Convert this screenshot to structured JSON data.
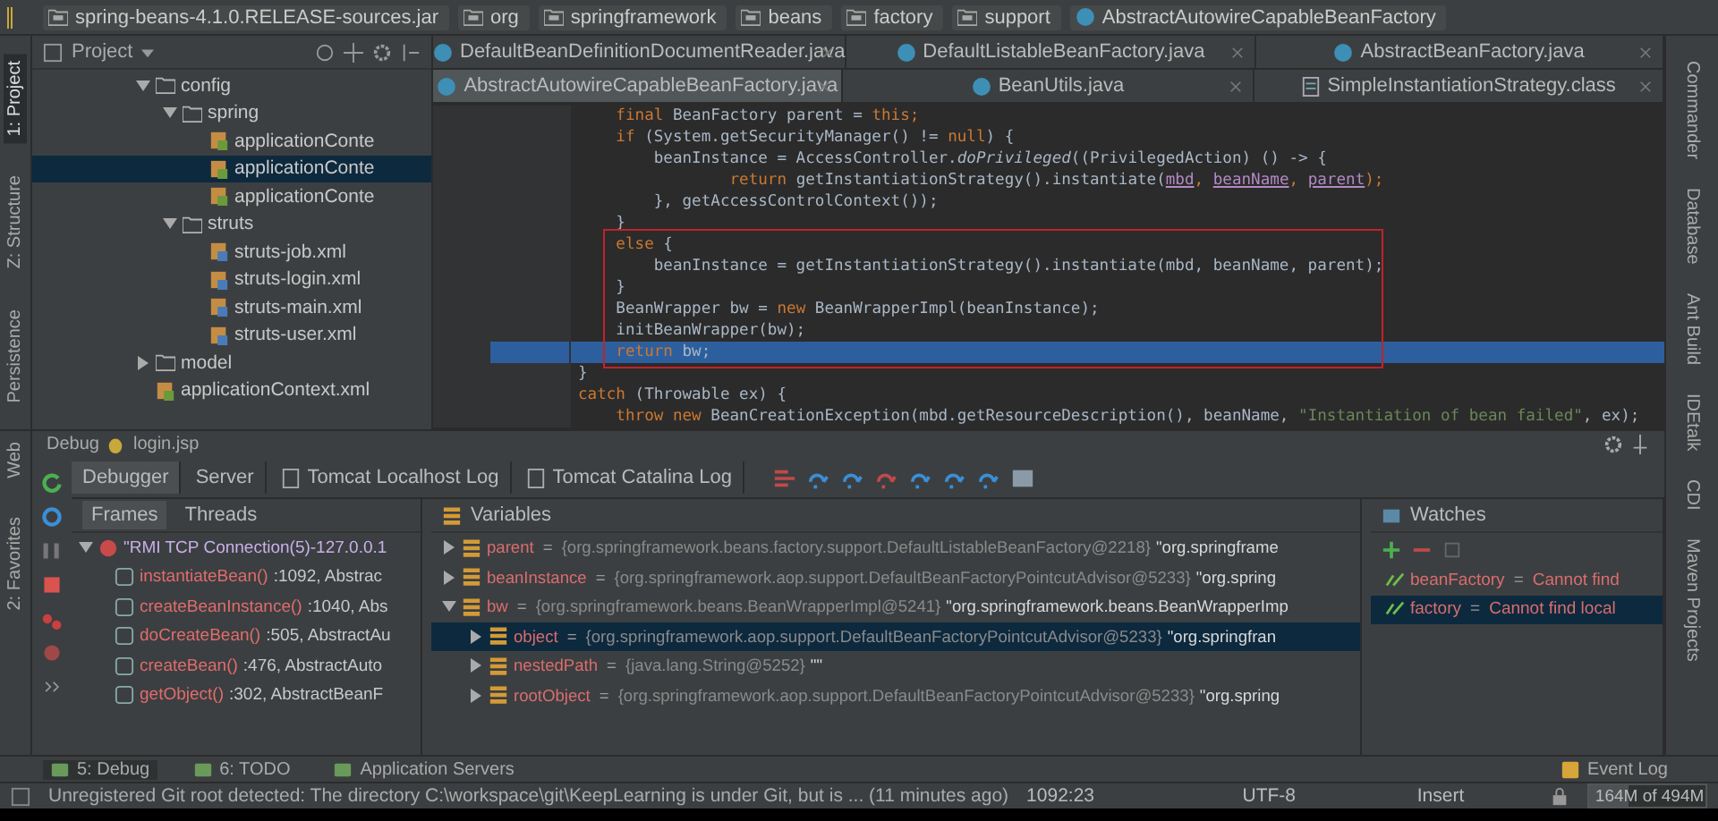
{
  "breadcrumbs": [
    {
      "label": "spring-beans-4.1.0.RELEASE-sources.jar",
      "kind": "jar"
    },
    {
      "label": "org",
      "kind": "package"
    },
    {
      "label": "springframework",
      "kind": "package"
    },
    {
      "label": "beans",
      "kind": "package"
    },
    {
      "label": "factory",
      "kind": "package"
    },
    {
      "label": "support",
      "kind": "package"
    },
    {
      "label": "AbstractAutowireCapableBeanFactory",
      "kind": "class"
    }
  ],
  "left_tool_strip": [
    {
      "label": "1: Project",
      "selected": true
    },
    {
      "label": "Z: Structure",
      "selected": false
    },
    {
      "label": "Persistence",
      "selected": false
    },
    {
      "label": "Web",
      "selected": false
    },
    {
      "label": "2: Favorites",
      "selected": false
    }
  ],
  "right_tool_strip": [
    "Commander",
    "Database",
    "Ant Build",
    "IDEtalk",
    "CDI",
    "Maven Projects"
  ],
  "project": {
    "title": "Project",
    "tree": [
      {
        "label": "config",
        "kind": "folder",
        "expanded": true,
        "selected": false,
        "children": [
          {
            "label": "spring",
            "kind": "folder",
            "expanded": true,
            "selected": false,
            "children": [
              {
                "label": "applicationConte",
                "kind": "spring-xml",
                "selected": false
              },
              {
                "label": "applicationConte",
                "kind": "spring-xml",
                "selected": true
              },
              {
                "label": "applicationConte",
                "kind": "spring-xml",
                "selected": false
              }
            ]
          },
          {
            "label": "struts",
            "kind": "folder",
            "expanded": true,
            "selected": false,
            "children": [
              {
                "label": "struts-job.xml",
                "kind": "xml",
                "selected": false
              },
              {
                "label": "struts-login.xml",
                "kind": "xml",
                "selected": false
              },
              {
                "label": "struts-main.xml",
                "kind": "xml",
                "selected": false
              },
              {
                "label": "struts-user.xml",
                "kind": "xml",
                "selected": false
              }
            ]
          }
        ]
      },
      {
        "label": "model",
        "kind": "folder",
        "expanded": false,
        "selected": false
      },
      {
        "label": "applicationContext.xml",
        "kind": "spring-xml",
        "selected": false
      }
    ]
  },
  "editor": {
    "tab_rows": [
      [
        {
          "label": "DefaultBeanDefinitionDocumentReader.java",
          "kind": "java",
          "selected": false
        },
        {
          "label": "DefaultListableBeanFactory.java",
          "kind": "java",
          "selected": false
        },
        {
          "label": "AbstractBeanFactory.java",
          "kind": "java",
          "selected": false
        }
      ],
      [
        {
          "label": "AbstractAutowireCapableBeanFactory.java",
          "kind": "java",
          "selected": true
        },
        {
          "label": "BeanUtils.java",
          "kind": "java",
          "selected": false
        },
        {
          "label": "SimpleInstantiationStrategy.class",
          "kind": "class",
          "selected": false
        }
      ]
    ],
    "lines": [
      {
        "current": false,
        "boxed": false,
        "segments": [
          {
            "text": "    final",
            "kind": "kw"
          },
          {
            "text": " BeanFactory parent = ",
            "kind": "plain"
          },
          {
            "text": "this",
            "kind": "kw"
          },
          {
            "text": ";",
            "kind": "kw"
          }
        ]
      },
      {
        "current": false,
        "boxed": false,
        "segments": [
          {
            "text": "    if",
            "kind": "kw"
          },
          {
            "text": " (System.getSecurityManager() != ",
            "kind": "plain"
          },
          {
            "text": "null",
            "kind": "kw"
          },
          {
            "text": ") {",
            "kind": "plain"
          }
        ]
      },
      {
        "current": false,
        "boxed": false,
        "segments": [
          {
            "text": "        beanInstance = AccessController.",
            "kind": "plain"
          },
          {
            "text": "doPrivileged",
            "kind": "italic"
          },
          {
            "text": "((PrivilegedAction) () -> {",
            "kind": "plain"
          }
        ]
      },
      {
        "current": false,
        "boxed": false,
        "segments": [
          {
            "text": "                return",
            "kind": "kw"
          },
          {
            "text": " getInstantiationStrategy().instantiate(",
            "kind": "plain"
          },
          {
            "text": "mbd",
            "kind": "param"
          },
          {
            "text": ", ",
            "kind": "kw"
          },
          {
            "text": "beanName",
            "kind": "param"
          },
          {
            "text": ", ",
            "kind": "kw"
          },
          {
            "text": "parent",
            "kind": "param"
          },
          {
            "text": ");",
            "kind": "kw"
          }
        ]
      },
      {
        "current": false,
        "boxed": false,
        "segments": [
          {
            "text": "        }, getAccessControlContext());",
            "kind": "plain"
          }
        ]
      },
      {
        "current": false,
        "boxed": false,
        "segments": [
          {
            "text": "    }",
            "kind": "plain"
          }
        ]
      },
      {
        "current": false,
        "boxed": true,
        "segments": [
          {
            "text": "    else",
            "kind": "kw"
          },
          {
            "text": " {",
            "kind": "plain"
          }
        ]
      },
      {
        "current": false,
        "boxed": true,
        "segments": [
          {
            "text": "        beanInstance = getInstantiationStrategy().instantiate(mbd, beanName, parent);",
            "kind": "plain"
          }
        ]
      },
      {
        "current": false,
        "boxed": true,
        "segments": [
          {
            "text": "    }",
            "kind": "plain"
          }
        ]
      },
      {
        "current": false,
        "boxed": true,
        "segments": [
          {
            "text": "    BeanWrapper bw = ",
            "kind": "plain"
          },
          {
            "text": "new",
            "kind": "kw"
          },
          {
            "text": " BeanWrapperImpl(beanInstance);",
            "kind": "plain"
          }
        ]
      },
      {
        "current": false,
        "boxed": true,
        "segments": [
          {
            "text": "    initBeanWrapper(bw);",
            "kind": "plain"
          }
        ]
      },
      {
        "current": true,
        "boxed": true,
        "segments": [
          {
            "text": "    return",
            "kind": "kw"
          },
          {
            "text": " bw;",
            "kind": "plain"
          }
        ]
      },
      {
        "current": false,
        "boxed": false,
        "segments": [
          {
            "text": "}",
            "kind": "plain"
          }
        ]
      },
      {
        "current": false,
        "boxed": false,
        "segments": [
          {
            "text": "catch",
            "kind": "kw"
          },
          {
            "text": " (Throwable ex) {",
            "kind": "plain"
          }
        ]
      },
      {
        "current": false,
        "boxed": false,
        "segments": [
          {
            "text": "    throw new",
            "kind": "kw"
          },
          {
            "text": " BeanCreationException(mbd.getResourceDescription(), beanName, ",
            "kind": "plain"
          },
          {
            "text": "\"Instantiation of bean failed\"",
            "kind": "string"
          },
          {
            "text": ", ex);",
            "kind": "plain"
          }
        ]
      }
    ]
  },
  "debug": {
    "title": "Debug",
    "config": "login.jsp",
    "tabs": [
      {
        "label": "Debugger",
        "kind": "plain",
        "selected": true
      },
      {
        "label": "Server",
        "kind": "plain",
        "selected": false
      },
      {
        "label": "Tomcat Localhost Log",
        "kind": "log",
        "selected": false
      },
      {
        "label": "Tomcat Catalina Log",
        "kind": "log",
        "selected": false
      }
    ],
    "frames": {
      "tabs": [
        {
          "label": "Frames",
          "selected": true
        },
        {
          "label": "Threads",
          "selected": false
        }
      ],
      "thread": {
        "label": "\"RMI TCP Connection(5)-127.0.0.1",
        "expanded": true
      },
      "items": [
        {
          "method": "instantiateBean()",
          "location": ":1092, Abstrac"
        },
        {
          "method": "createBeanInstance()",
          "location": ":1040, Abs"
        },
        {
          "method": "doCreateBean()",
          "location": ":505, AbstractAu"
        },
        {
          "method": "createBean()",
          "location": ":476, AbstractAuto"
        },
        {
          "method": "getObject()",
          "location": ":302, AbstractBeanF"
        }
      ]
    },
    "variables": {
      "title": "Variables",
      "items": [
        {
          "name": "parent",
          "op": "=",
          "ref": "{org.springframework.beans.factory.support.DefaultListableBeanFactory@2218}",
          "value": "\"org.springframe",
          "expanded": false,
          "selected": false
        },
        {
          "name": "beanInstance",
          "op": "=",
          "ref": "{org.springframework.aop.support.DefaultBeanFactoryPointcutAdvisor@5233}",
          "value": "\"org.spring",
          "expanded": false,
          "selected": false
        },
        {
          "name": "bw",
          "op": "=",
          "ref": "{org.springframework.beans.BeanWrapperImpl@5241}",
          "value": "\"org.springframework.beans.BeanWrapperImp",
          "expanded": true,
          "selected": false,
          "children": [
            {
              "name": "object",
              "op": "=",
              "ref": "{org.springframework.aop.support.DefaultBeanFactoryPointcutAdvisor@5233}",
              "value": "\"org.springfran",
              "expanded": false,
              "selected": true
            },
            {
              "name": "nestedPath",
              "op": "=",
              "ref": "{java.lang.String@5252}",
              "value": "\"\"",
              "expanded": false,
              "selected": false
            },
            {
              "name": "rootObject",
              "op": "=",
              "ref": "{org.springframework.aop.support.DefaultBeanFactoryPointcutAdvisor@5233}",
              "value": "\"org.spring",
              "expanded": false,
              "selected": false
            }
          ]
        }
      ]
    },
    "watches": {
      "title": "Watches",
      "items": [
        {
          "name": "beanFactory",
          "op": "=",
          "error": "Cannot find",
          "selected": false
        },
        {
          "name": "factory",
          "op": "=",
          "error": "Cannot find local",
          "selected": true
        }
      ]
    }
  },
  "tool_buttons": [
    {
      "label": "5: Debug",
      "selected": true
    },
    {
      "label": "6: TODO",
      "selected": false
    },
    {
      "label": "Application Servers",
      "selected": false
    }
  ],
  "event_log": "Event Log",
  "status_bar": {
    "message": "Unregistered Git root detected: The directory C:\\workspace\\git\\KeepLearning is under Git, but is ... (11 minutes ago)",
    "position": "1092:23",
    "encoding": "UTF-8",
    "mode": "Insert",
    "memory": "164M of 494M",
    "level": 0.33
  }
}
